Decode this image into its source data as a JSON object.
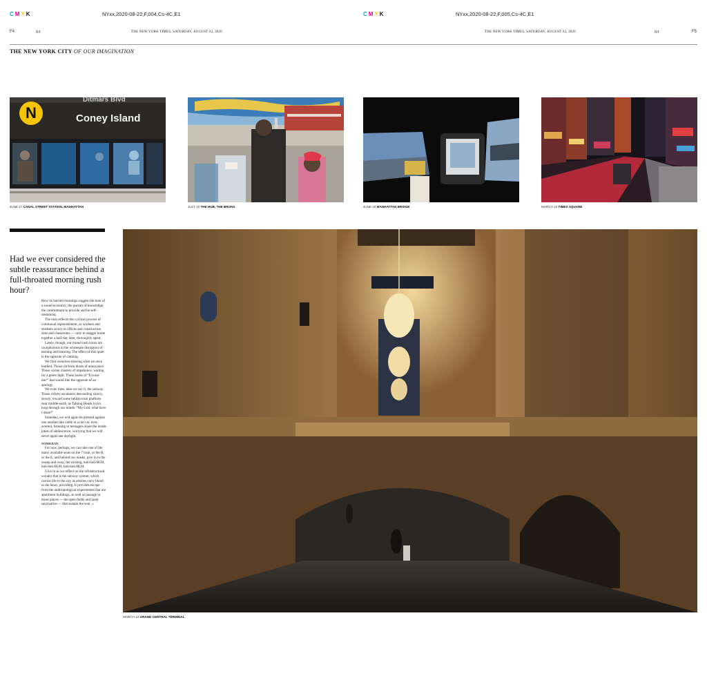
{
  "header": {
    "left": {
      "cmyk": [
        "C",
        "M",
        "Y",
        "K"
      ],
      "slug": "NYxx,2020-08-22,F,004,Cs-4C,E1",
      "folio": "F4",
      "edition": "NY",
      "dateline": "THE NEW YORK TIMES, SATURDAY, AUGUST 22, 2020"
    },
    "right": {
      "cmyk": [
        "C",
        "M",
        "Y",
        "K"
      ],
      "slug": "NYxx,2020-08-22,F,005,Cs-4C,E1",
      "folio": "F5",
      "edition": "NY",
      "dateline": "THE NEW YORK TIMES, SATURDAY, AUGUST 22, 2020"
    }
  },
  "section": {
    "bold": "THE NEW YORK CITY",
    "italic": "OF OUR IMAGINATION"
  },
  "photos": [
    {
      "date": "JUNE 17",
      "place": "CANAL STREET STATION, MANHATTAN",
      "sign_letter": "N",
      "sign_text": "Coney Island",
      "sign_top": "Ditmars Blvd"
    },
    {
      "date": "JULY 16",
      "place": "THE HUB, THE BRONX"
    },
    {
      "date": "JUNE 26",
      "place": "MANHATTAN BRIDGE"
    },
    {
      "date": "MARCH 18",
      "place": "TIMES SQUARE"
    }
  ],
  "main_photo": {
    "date": "MARCH 12",
    "place": "GRAND CENTRAL TERMINAL"
  },
  "article": {
    "headline": "Had we ever considered the subtle reassurance behind a full-throated morning rush hour?",
    "paragraphs": [
      "How its harried mornings suggest the hum of a sound economy; the pursuit of knowledge; the commitment to provide and be self-sustaining.",
      "The rush reflects the cyclical process of communal replenishment, as workers and students scurry to offices and construction sites and classrooms — only to stagger home together a half-day later, thoroughly spent.",
      "Lately, though, our muted rush hours are cacophonous in the wholesale disruption of earning and learning. The effect of this quiet is the opposite of calming.",
      "We find ourselves missing what we once loathed. Those car-horn blasts of annoyance. Those corner clusters of impatience, waiting for a green light. Those barks of “Excuse me!” that sound like the opposite of an apology.",
      "We even miss, dare we say it, the subway. Those rickety escalators descending slowly, slowly, toward some hellish train platform near middle-earth, as Talking Heads lyrics loop through our minds: “My God, what have I done?”",
      "Someday, we will again be pressed against one another like cattle in a rail car, eyes averted, listening to teenagers share the inside jokes of adolescence, worrying that we will never again see daylight."
    ],
    "subhead": "SOMEDAY.",
    "paragraphs2": [
      "For now, perhaps, we can take one of the many available seats on the 7 train, or the B, or the E, and behind our masks, give in to the sweep and sway, the rocking, buh-buh-BUH, buh-buh-BUH, buh-buh-BUH.",
      "Give in as we reflect on the infrastructural wonder that is the subway system, which carries life to the city as arteries carry blood to the heart, providing. It provides escape from the anthropological experiments that are apartment buildings, as well as passage to those places — the open fields and quiet sanctuaries — that sustain the soul. »"
    ]
  },
  "colors": {
    "cyan": "#00a3e0",
    "magenta": "#e4007c",
    "yellow": "#f5d200",
    "black": "#111111"
  }
}
